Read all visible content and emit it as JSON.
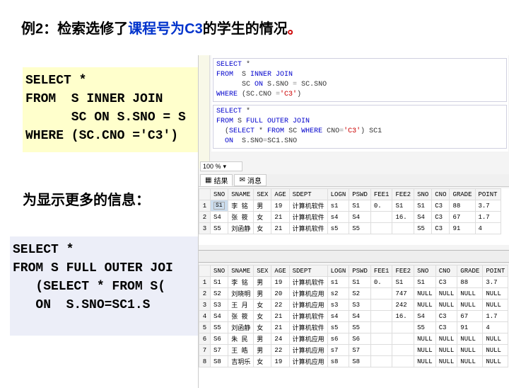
{
  "title_pre": "例2：检索选修了",
  "title_hl": "课程号为C3",
  "title_post": "的学生的情况",
  "title_dot": "。",
  "code1_l1": "SELECT *",
  "code1_l2": "FROM  S INNER JOIN",
  "code1_l3": "      SC ON S.SNO = S",
  "code1_l4": "WHERE (SC.CNO ='C3')",
  "mid_text": "为显示更多的信息：",
  "code2_l1": "SELECT *",
  "code2_l2": "FROM S FULL OUTER JOI",
  "code2_l3": "   (SELECT * FROM S(",
  "code2_l4": "   ON  S.SNO=SC1.S",
  "sql1_l1_a": "SELECT",
  "sql1_l1_b": " *",
  "sql1_l2_a": "FROM",
  "sql1_l2_b": "  S ",
  "sql1_l2_c": "INNER JOIN",
  "sql1_l3_a": "      SC ",
  "sql1_l3_b": "ON",
  "sql1_l3_c": " S.SNO ",
  "sql1_l3_d": "=",
  "sql1_l3_e": " SC.SNO",
  "sql1_l4_a": "WHERE",
  "sql1_l4_b": " (SC.CNO ",
  "sql1_l4_c": "=",
  "sql1_l4_d": "'C3'",
  "sql1_l4_e": ")",
  "sql2_l1_a": "SELECT",
  "sql2_l1_b": " *",
  "sql2_l2_a": "FROM",
  "sql2_l2_b": " S ",
  "sql2_l2_c": "FULL OUTER JOIN",
  "sql2_l3_a": "  (",
  "sql2_l3_b": "SELECT",
  "sql2_l3_c": " * ",
  "sql2_l3_d": "FROM",
  "sql2_l3_e": " SC ",
  "sql2_l3_f": "WHERE",
  "sql2_l3_g": " CNO",
  "sql2_l3_h": "=",
  "sql2_l3_i": "'C3'",
  "sql2_l3_j": ") SC1",
  "sql2_l4_a": "  ",
  "sql2_l4_b": "ON",
  "sql2_l4_c": "  S.SNO",
  "sql2_l4_d": "=",
  "sql2_l4_e": "SC1.SNO",
  "zoom_val": "100 %",
  "tab_results": "结果",
  "tab_messages": "消息",
  "hdr": [
    "SNO",
    "SNAME",
    "SEX",
    "AGE",
    "SDEPT",
    "LOGN",
    "PSWD",
    "FEE1",
    "FEE2",
    "SNO",
    "CNO",
    "GRADE",
    "POINT"
  ],
  "t1": [
    [
      "S1",
      "李 铭",
      "男",
      "19",
      "计算机软件",
      "s1",
      "S1",
      "0.",
      "S1",
      "S1",
      "C3",
      "88",
      "3.7"
    ],
    [
      "S4",
      "张 筱",
      "女",
      "21",
      "计算机软件",
      "s4",
      "S4",
      "",
      "16.",
      "S4",
      "C3",
      "67",
      "1.7"
    ],
    [
      "S5",
      "刘函静",
      "女",
      "21",
      "计算机软件",
      "s5",
      "S5",
      "",
      "",
      "S5",
      "C3",
      "91",
      "4"
    ]
  ],
  "t2": [
    [
      "S1",
      "李 铭",
      "男",
      "19",
      "计算机软件",
      "s1",
      "S1",
      "0.",
      "S1",
      "S1",
      "C3",
      "88",
      "3.7"
    ],
    [
      "S2",
      "刘晓明",
      "男",
      "20",
      "计算机应用",
      "s2",
      "S2",
      "",
      "747",
      "NULL",
      "NULL",
      "NULL",
      "NULL"
    ],
    [
      "S3",
      "王 月",
      "女",
      "22",
      "计算机应用",
      "s3",
      "S3",
      "",
      "242",
      "NULL",
      "NULL",
      "NULL",
      "NULL"
    ],
    [
      "S4",
      "张 筱",
      "女",
      "21",
      "计算机软件",
      "s4",
      "S4",
      "",
      "16.",
      "S4",
      "C3",
      "67",
      "1.7"
    ],
    [
      "S5",
      "刘函静",
      "女",
      "21",
      "计算机软件",
      "s5",
      "S5",
      "",
      "",
      "S5",
      "C3",
      "91",
      "4"
    ],
    [
      "S6",
      "朱 民",
      "男",
      "24",
      "计算机应用",
      "s6",
      "S6",
      "",
      "",
      "NULL",
      "NULL",
      "NULL",
      "NULL"
    ],
    [
      "S7",
      "王 皓",
      "男",
      "22",
      "计算机应用",
      "s7",
      "S7",
      "",
      "",
      "NULL",
      "NULL",
      "NULL",
      "NULL"
    ],
    [
      "S8",
      "吉玥乐",
      "女",
      "19",
      "计算机应用",
      "s8",
      "S8",
      "",
      "",
      "NULL",
      "NULL",
      "NULL",
      "NULL"
    ]
  ]
}
